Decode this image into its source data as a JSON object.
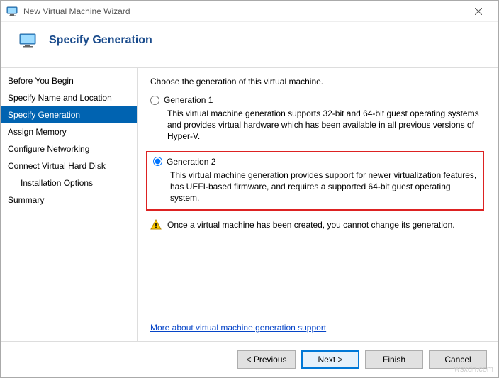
{
  "window": {
    "title": "New Virtual Machine Wizard"
  },
  "header": {
    "title": "Specify Generation"
  },
  "sidebar": {
    "items": [
      {
        "label": "Before You Begin"
      },
      {
        "label": "Specify Name and Location"
      },
      {
        "label": "Specify Generation"
      },
      {
        "label": "Assign Memory"
      },
      {
        "label": "Configure Networking"
      },
      {
        "label": "Connect Virtual Hard Disk"
      },
      {
        "label": "Installation Options"
      },
      {
        "label": "Summary"
      }
    ]
  },
  "main": {
    "intro": "Choose the generation of this virtual machine.",
    "gen1": {
      "label": "Generation 1",
      "desc": "This virtual machine generation supports 32-bit and 64-bit guest operating systems and provides virtual hardware which has been available in all previous versions of Hyper-V."
    },
    "gen2": {
      "label": "Generation 2",
      "desc": "This virtual machine generation provides support for newer virtualization features, has UEFI-based firmware, and requires a supported 64-bit guest operating system."
    },
    "warning": "Once a virtual machine has been created, you cannot change its generation.",
    "link": "More about virtual machine generation support"
  },
  "footer": {
    "previous": "< Previous",
    "next": "Next >",
    "finish": "Finish",
    "cancel": "Cancel"
  },
  "watermark": "wsxdn.com"
}
